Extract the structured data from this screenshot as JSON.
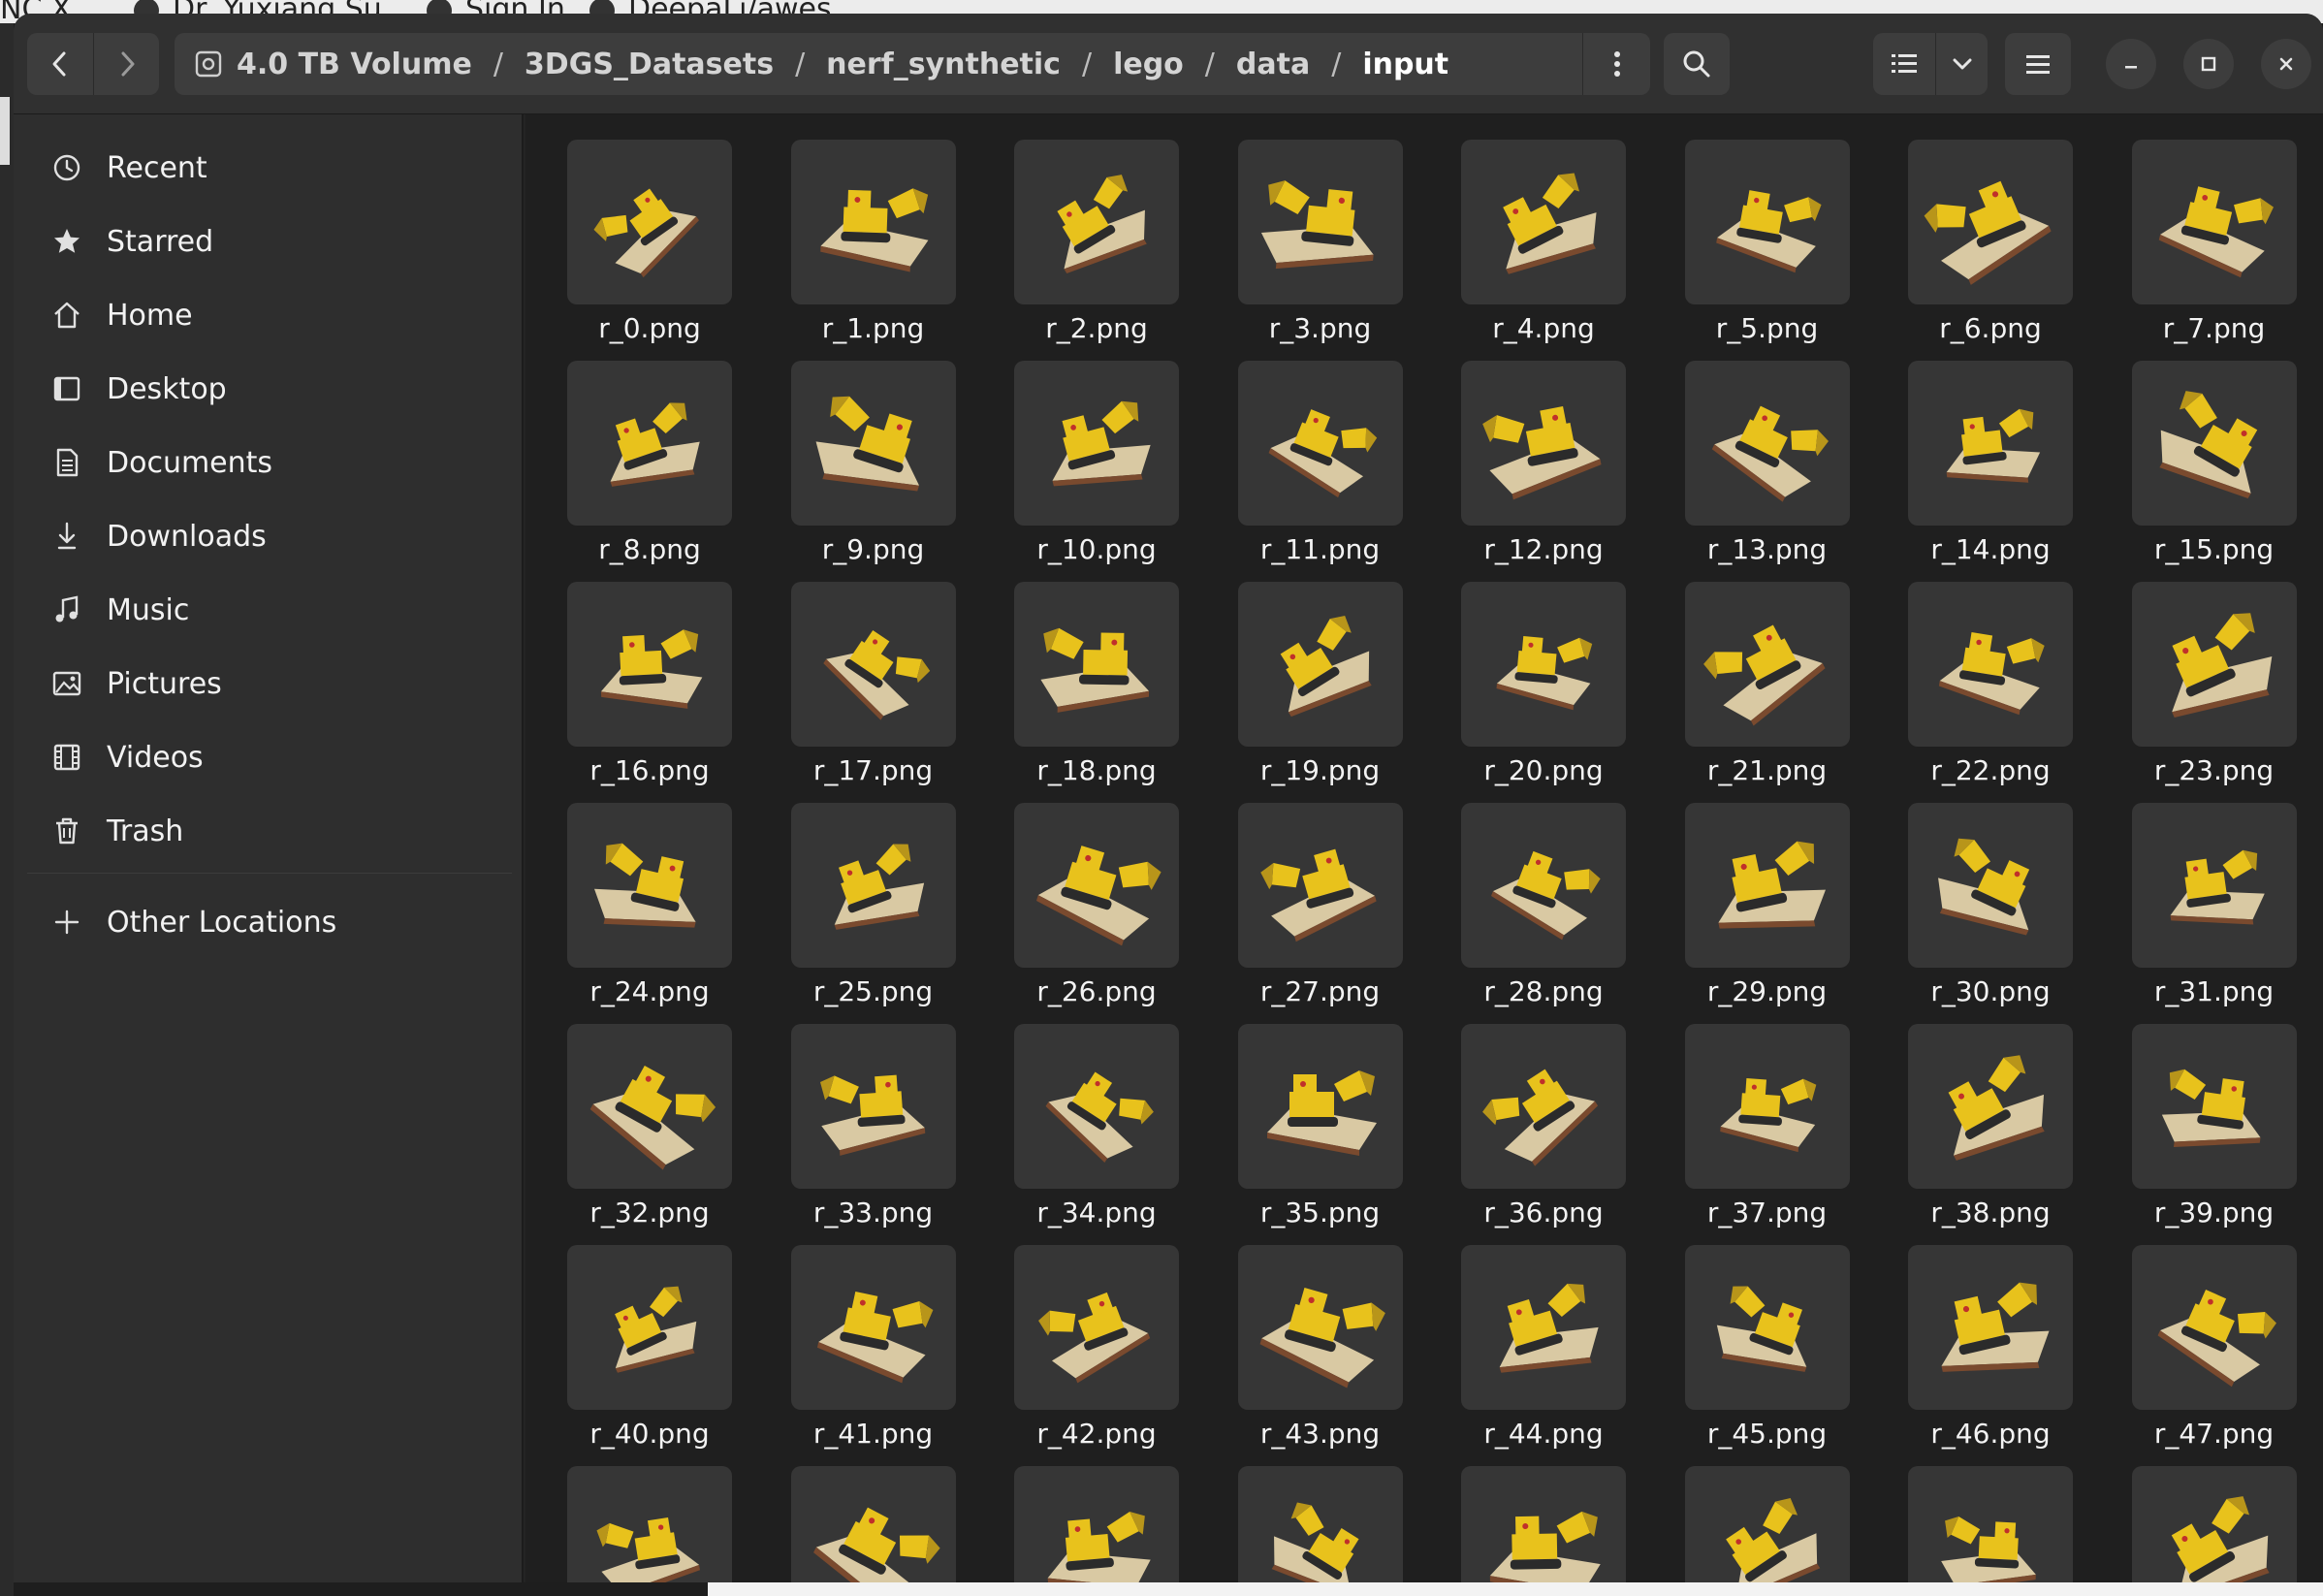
{
  "background": {
    "tabs": [
      "NC X",
      "Dr. Yuxiang Su...",
      "Sign In",
      "DeepaLi/awes..."
    ]
  },
  "toolbar": {
    "back_icon": "chevron-left-icon",
    "forward_icon": "chevron-right-icon",
    "path_menu_icon": "vertical-dots-icon",
    "search_icon": "search-icon",
    "list_view_icon": "list-view-icon",
    "view_options_icon": "chevron-down-icon",
    "main_menu_icon": "hamburger-icon",
    "minimize_icon": "minimize-icon",
    "maximize_icon": "maximize-icon",
    "close_icon": "close-icon"
  },
  "path": [
    "4.0 TB Volume",
    "3DGS_Datasets",
    "nerf_synthetic",
    "lego",
    "data",
    "input"
  ],
  "sidebar": {
    "items": [
      {
        "label": "Recent",
        "icon": "clock-icon"
      },
      {
        "label": "Starred",
        "icon": "star-icon"
      },
      {
        "label": "Home",
        "icon": "home-icon"
      },
      {
        "label": "Desktop",
        "icon": "desktop-icon"
      },
      {
        "label": "Documents",
        "icon": "document-icon"
      },
      {
        "label": "Downloads",
        "icon": "download-icon"
      },
      {
        "label": "Music",
        "icon": "music-icon"
      },
      {
        "label": "Pictures",
        "icon": "picture-icon"
      },
      {
        "label": "Videos",
        "icon": "video-icon"
      },
      {
        "label": "Trash",
        "icon": "trash-icon"
      }
    ],
    "other_locations": {
      "label": "Other Locations",
      "icon": "plus-icon"
    }
  },
  "files": [
    "r_0.png",
    "r_1.png",
    "r_2.png",
    "r_3.png",
    "r_4.png",
    "r_5.png",
    "r_6.png",
    "r_7.png",
    "r_8.png",
    "r_9.png",
    "r_10.png",
    "r_11.png",
    "r_12.png",
    "r_13.png",
    "r_14.png",
    "r_15.png",
    "r_16.png",
    "r_17.png",
    "r_18.png",
    "r_19.png",
    "r_20.png",
    "r_21.png",
    "r_22.png",
    "r_23.png",
    "r_24.png",
    "r_25.png",
    "r_26.png",
    "r_27.png",
    "r_28.png",
    "r_29.png",
    "r_30.png",
    "r_31.png",
    "r_32.png",
    "r_33.png",
    "r_34.png",
    "r_35.png",
    "r_36.png",
    "r_37.png",
    "r_38.png",
    "r_39.png",
    "r_40.png",
    "r_41.png",
    "r_42.png",
    "r_43.png",
    "r_44.png",
    "r_45.png",
    "r_46.png",
    "r_47.png",
    "",
    "",
    "",
    "",
    "",
    "",
    "",
    ""
  ],
  "colors": {
    "window_bg": "#242424",
    "headerbar": "#303030",
    "sidebar": "#2e2e2e",
    "thumb_bg": "#363636",
    "lego_yellow": "#e8c21c"
  }
}
